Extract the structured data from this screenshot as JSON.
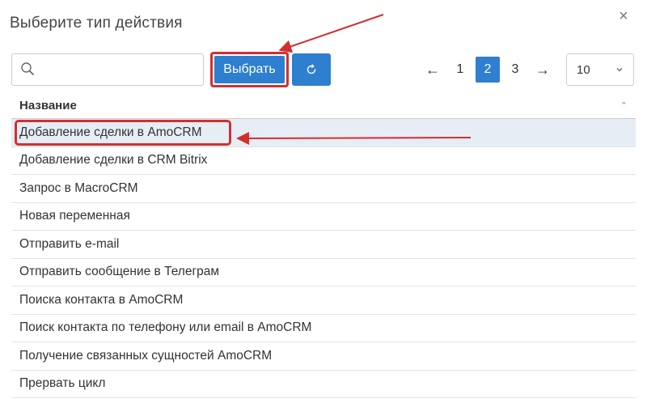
{
  "dialog": {
    "title": "Выберите тип действия",
    "close_symbol": "×"
  },
  "toolbar": {
    "search": {
      "value": "",
      "placeholder": "",
      "icon": "search-icon"
    },
    "choose_label": "Выбрать",
    "refresh_icon": "refresh-icon"
  },
  "pager": {
    "prev_symbol": "←",
    "next_symbol": "→",
    "pages": [
      "1",
      "2",
      "3"
    ],
    "current_page": "2",
    "page_size": "10"
  },
  "table": {
    "header": "Название",
    "rows": [
      "Добавление сделки в AmoCRM",
      "Добавление сделки в CRM Bitrix",
      "Запрос в MacroCRM",
      "Новая переменная",
      "Отправить e-mail",
      "Отправить сообщение в Телеграм",
      "Поиска контакта в AmoCRM",
      "Поиск контакта по телефону или email в AmoCRM",
      "Получение связанных сущностей AmoCRM",
      "Прервать цикл"
    ],
    "selected_row": 0
  },
  "colors": {
    "primary": "#2e7fcf",
    "annotation": "#d32f2f",
    "selected_row_bg": "#e6edf5"
  }
}
